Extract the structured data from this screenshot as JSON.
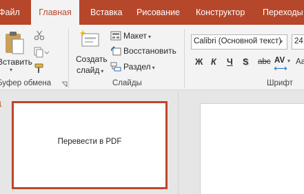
{
  "tabs": [
    {
      "label": "Файл",
      "active": false
    },
    {
      "label": "Главная",
      "active": true
    },
    {
      "label": "Вставка",
      "active": false
    },
    {
      "label": "Рисование",
      "active": false
    },
    {
      "label": "Конструктор",
      "active": false
    },
    {
      "label": "Переходы",
      "active": false
    }
  ],
  "clipboard": {
    "paste_label": "Вставить",
    "group_label": "Буфер обмена"
  },
  "slides_group": {
    "new_slide_line1": "Создать",
    "new_slide_line2": "слайд",
    "layout_label": "Макет",
    "reset_label": "Восстановить",
    "section_label": "Раздел",
    "group_label": "Слайды"
  },
  "font_group": {
    "font_name": "Calibri (Основной текст)",
    "font_size": "24",
    "bold": "Ж",
    "italic": "К",
    "underline": "Ч",
    "shadow": "S",
    "strike": "abc",
    "spacing": "AV",
    "case": "Аа",
    "group_label": "Шрифт"
  },
  "thumbnails": {
    "slide_number": "1",
    "slide_text": "Перевести в PDF"
  },
  "colors": {
    "accent": "#b7472a",
    "ribbon_bg": "#f3f3f3",
    "workspace_bg": "#e6e6e6",
    "selection": "#c0442a"
  }
}
